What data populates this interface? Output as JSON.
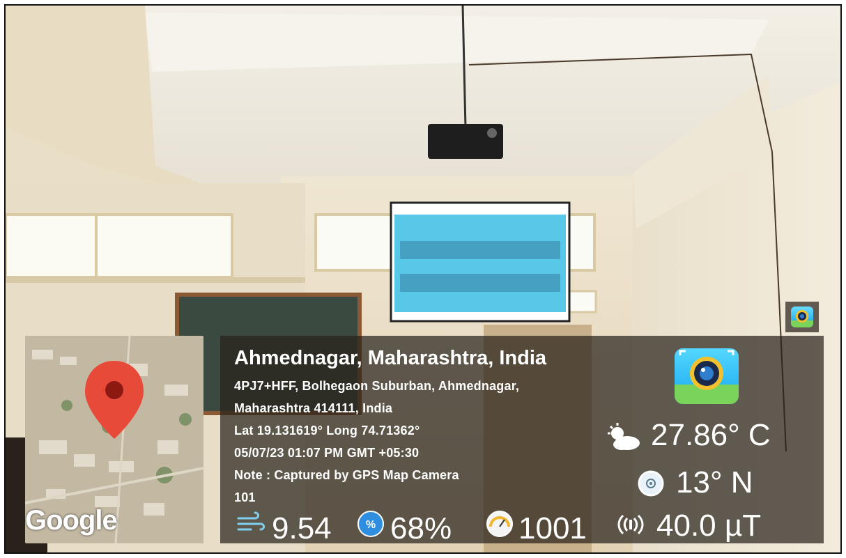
{
  "location": {
    "title": "Ahmednagar, Maharashtra, India",
    "address_line1": "4PJ7+HFF, Bolhegaon Suburban, Ahmednagar,",
    "address_line2": "Maharashtra 414111, India",
    "coords": "Lat 19.131619° Long 74.71362°",
    "datetime": "05/07/23 01:07 PM GMT +05:30",
    "note": "Note : Captured by GPS Map Camera",
    "note_extra": "101"
  },
  "map": {
    "brand": "Google",
    "pin_color": "#e84a3a"
  },
  "readings": {
    "temperature": "27.86° C",
    "direction": "13° N",
    "magnetic": "40.0 µT",
    "wind": "9.54",
    "humidity": "68%",
    "pressure": "1001"
  },
  "icons": {
    "weather": "partly-cloudy-icon",
    "compass": "compass-icon",
    "magnet": "magnetic-field-icon",
    "wind": "wind-icon",
    "humidity": "humidity-icon",
    "pressure": "gauge-icon",
    "app": "gps-camera-app-icon"
  }
}
